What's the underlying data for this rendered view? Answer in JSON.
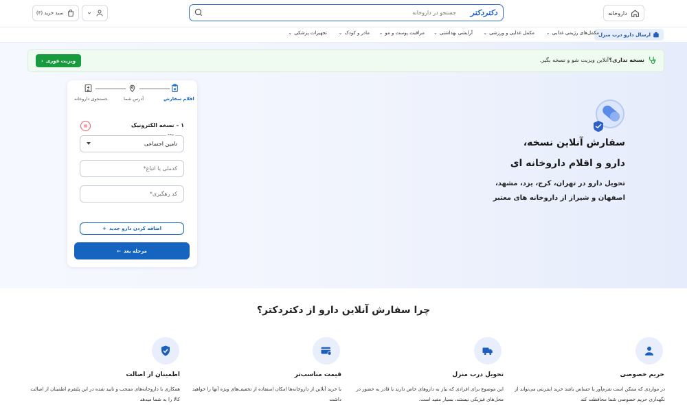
{
  "header": {
    "pharmacy_label": "داروخانه",
    "search_placeholder": "جستجو در داروخانه",
    "brand": "دکتردکتر",
    "cart_label": "سبد خرید (۳)"
  },
  "nav": {
    "items": [
      {
        "label": "ارسال دارو درب منزل",
        "active": true
      },
      {
        "label": "مکمل‌های رژیمی غذایی"
      },
      {
        "label": "مکمل غذایی و ورزشی"
      },
      {
        "label": "آرایشی بهداشتی"
      },
      {
        "label": "مراقبت پوست و مو"
      },
      {
        "label": "مادر و کودک"
      },
      {
        "label": "تجهیزات پزشکی"
      }
    ]
  },
  "banner": {
    "bold": "نسخه نداری؟",
    "text": "آنلاین ویزیت شو و نسخه بگیر.",
    "button": "ویزیت فوری"
  },
  "stepper": {
    "steps": [
      {
        "label": "اقلام سفارش",
        "active": true
      },
      {
        "label": "آدرس شما"
      },
      {
        "label": "جستجوی داروخانه"
      }
    ]
  },
  "form": {
    "prescription_title": "۱ – نسخه الکترونیک",
    "insurance_legend": "بیمه",
    "insurance_value": "تامین اجتماعی",
    "national_code_placeholder": "کدملی یا اتباع*",
    "tracking_code_placeholder": "کد رهگیری*",
    "add_drug": "اضافه کردن دارو جدید",
    "next_step": "مرحله بعد"
  },
  "hero": {
    "line1": "سفارش آنلاین نسخه،",
    "line2": "دارو و اقلام داروخانه ای",
    "line3": "تحویل دارو در تهران، کرج، یزد، مشهد،",
    "line4": "اصفهان و شیراز از داروخانه های معتبر"
  },
  "features": {
    "title": "چرا سفارش آنلاین دارو از دکتردکتر؟",
    "items": [
      {
        "title": "حریم خصوصی",
        "desc": "در مواردی که ممکن است شرم‌آور یا حساس باشد خرید اینترنتی می‌تواند از نگهداری حریم خصوصی شما محافظت کند",
        "icon": "user-icon"
      },
      {
        "title": "تحویل درب منزل",
        "desc": "این موضوع برای افرادی که نیاز به داروهای خاص دارند یا قادر به حضور در محل‌های فیزیکی نیستند، بسیار مفید است.",
        "icon": "delivery-truck-icon"
      },
      {
        "title": "قیمت مناسب‌تر",
        "desc": "با خرید آنلاین از داروخانه‌ها امکان استفاده از تخفیف‌های ویژه آنها را خواهید داشت",
        "icon": "credit-card-icon"
      },
      {
        "title": "اطمینان از اصالت",
        "desc": "همکاری با داروخانه‌های منتخب و تایید شده در این پلتفرم اطمینان از اصالت کالا را به شما میدهد",
        "icon": "shield-check-icon"
      }
    ]
  },
  "colors": {
    "primary": "#1565c0",
    "green": "#189a3e"
  }
}
